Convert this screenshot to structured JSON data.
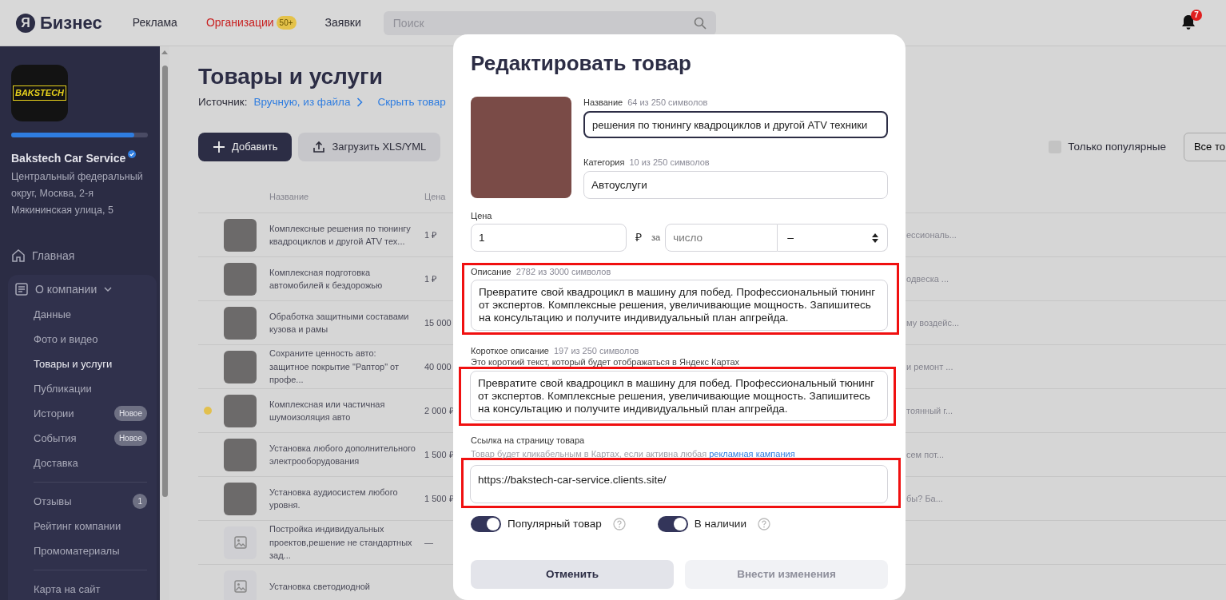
{
  "header": {
    "logo": {
      "mark": "Я",
      "text": "Бизнес"
    },
    "nav": [
      {
        "label": "Реклама",
        "selected": false
      },
      {
        "label": "Организации",
        "selected": true,
        "badge": "50+"
      },
      {
        "label": "Заявки",
        "selected": false
      }
    ],
    "search": {
      "placeholder": "Поиск"
    },
    "notifications": {
      "count": "7"
    }
  },
  "sidebar": {
    "logo_text": "BAKSTECH",
    "profile": {
      "level": 0.9
    },
    "company_name": "Bakstech Car Service",
    "verified": true,
    "address": "Центральный федеральный округ, Москва, 2-я Мякининская улица, 5",
    "items": [
      {
        "label": "Главная",
        "selected": false
      },
      {
        "label": "О компании",
        "selected": false,
        "expanded": true,
        "children": [
          {
            "label": "Данные",
            "selected": false
          },
          {
            "label": "Фото и видео",
            "selected": false
          },
          {
            "label": "Товары и услуги",
            "selected": true
          },
          {
            "label": "Публикации",
            "selected": false
          },
          {
            "label": "Истории",
            "selected": false,
            "badge": "Новое"
          },
          {
            "label": "События",
            "selected": false,
            "badge": "Новое"
          },
          {
            "label": "Доставка",
            "selected": false
          },
          {
            "label": "Отзывы",
            "selected": false,
            "badge": "1",
            "divider_before": true
          },
          {
            "label": "Рейтинг компании",
            "selected": false
          },
          {
            "label": "Промоматериалы",
            "selected": false
          },
          {
            "label": "Карта на сайт",
            "selected": false,
            "divider_before": true
          }
        ]
      }
    ]
  },
  "page": {
    "title": "Товары и услуги",
    "source_label": "Источник:",
    "source_link": "Вручную, из файла",
    "hide_link": "Скрыть товар",
    "buttons": [
      {
        "label": "Добавить",
        "kind": "primary"
      },
      {
        "label": "Загрузить XLS/YML",
        "kind": "secondary"
      }
    ],
    "filter": {
      "label": "Только популярные",
      "checked": false
    },
    "view_button": "Все то",
    "table": {
      "columns": [
        "Название",
        "Цена"
      ],
      "rows": [
        {
          "kind": "photo",
          "title": "Комплексные решения по тюнингу квадроциклов и другой ATV тех...",
          "price": "1 ₽",
          "column_3": "ессиональ...",
          "marked": false
        },
        {
          "kind": "photo",
          "title": "Комплексная подготовка автомобилей к бездорожью",
          "price": "1 ₽",
          "column_3": "одвеска ...",
          "marked": false
        },
        {
          "kind": "photo",
          "title": "Обработка защитными составами кузова и рамы",
          "price": "15 000",
          "column_3": "му воздейс...",
          "marked": false
        },
        {
          "kind": "photo",
          "title": "Сохраните ценность авто: защитное покрытие \"Раптор\" от профе...",
          "price": "40 000",
          "column_3": "и ремонт ...",
          "marked": false
        },
        {
          "kind": "photo",
          "title": "Комплексная или частичная шумоизоляция авто",
          "price": "2 000 ₽",
          "column_3": "тоянный г...",
          "marked": true
        },
        {
          "kind": "photo",
          "title": "Установка любого дополнительного электрооборудования",
          "price": "1 500 ₽",
          "column_3": "сем пот...",
          "marked": false
        },
        {
          "kind": "photo",
          "title": "Установка аудиосистем любого уровня.",
          "price": "1 500 ₽",
          "column_3": "бы? Ба...",
          "marked": false
        },
        {
          "kind": "placeholder",
          "title": "Постройка индивидуальных проектов,решение не стандартных зад...",
          "price": "—",
          "marked": false
        },
        {
          "kind": "placeholder",
          "title": "Установка светодиодной",
          "marked": false
        }
      ]
    }
  },
  "modal": {
    "title": "Редактировать товар",
    "name": {
      "label": "Название",
      "counter": "64 из 250 символов",
      "value": "решения по тюнингу квадроциклов и другой ATV техники",
      "focused": true
    },
    "category": {
      "label": "Категория",
      "counter": "10 из 250 символов",
      "value": "Автоуслуги"
    },
    "price": {
      "label": "Цена",
      "value": "1",
      "currency": "₽",
      "per": "за",
      "quantity_placeholder": "число",
      "unit": "–"
    },
    "description": {
      "label": "Описание",
      "counter": "2782 из 3000 символов",
      "value": "Превратите свой квадроцикл в машину для побед. Профессиональный тюнинг от экспертов. Комплексные решения, увеличивающие мощность. Запишитесь на консультацию и получите индивидуальный план апгрейда.",
      "highlighted": true
    },
    "short_description": {
      "label": "Короткое описание",
      "counter": "197 из 250 символов",
      "hint": "Это короткий текст, который будет отображаться в Яндекс Картах",
      "value": "Превратите свой квадроцикл в машину для побед. Профессиональный тюнинг от экспертов. Комплексные решения, увеличивающие мощность. Запишитесь на консультацию и получите индивидуальный план апгрейда.",
      "highlighted": true
    },
    "link": {
      "label": "Ссылка на страницу товара",
      "hint": "Товар будет кликабельным в Картах, если активна любая",
      "hint_link": "рекламная кампания",
      "value": "https://bakstech-car-service.clients.site/",
      "highlighted": true
    },
    "toggles": [
      {
        "label": "Популярный товар",
        "on": true
      },
      {
        "label": "В наличии",
        "on": true
      }
    ],
    "buttons": [
      {
        "label": "Отменить",
        "disabled": false
      },
      {
        "label": "Внести изменения",
        "disabled": true
      }
    ]
  }
}
